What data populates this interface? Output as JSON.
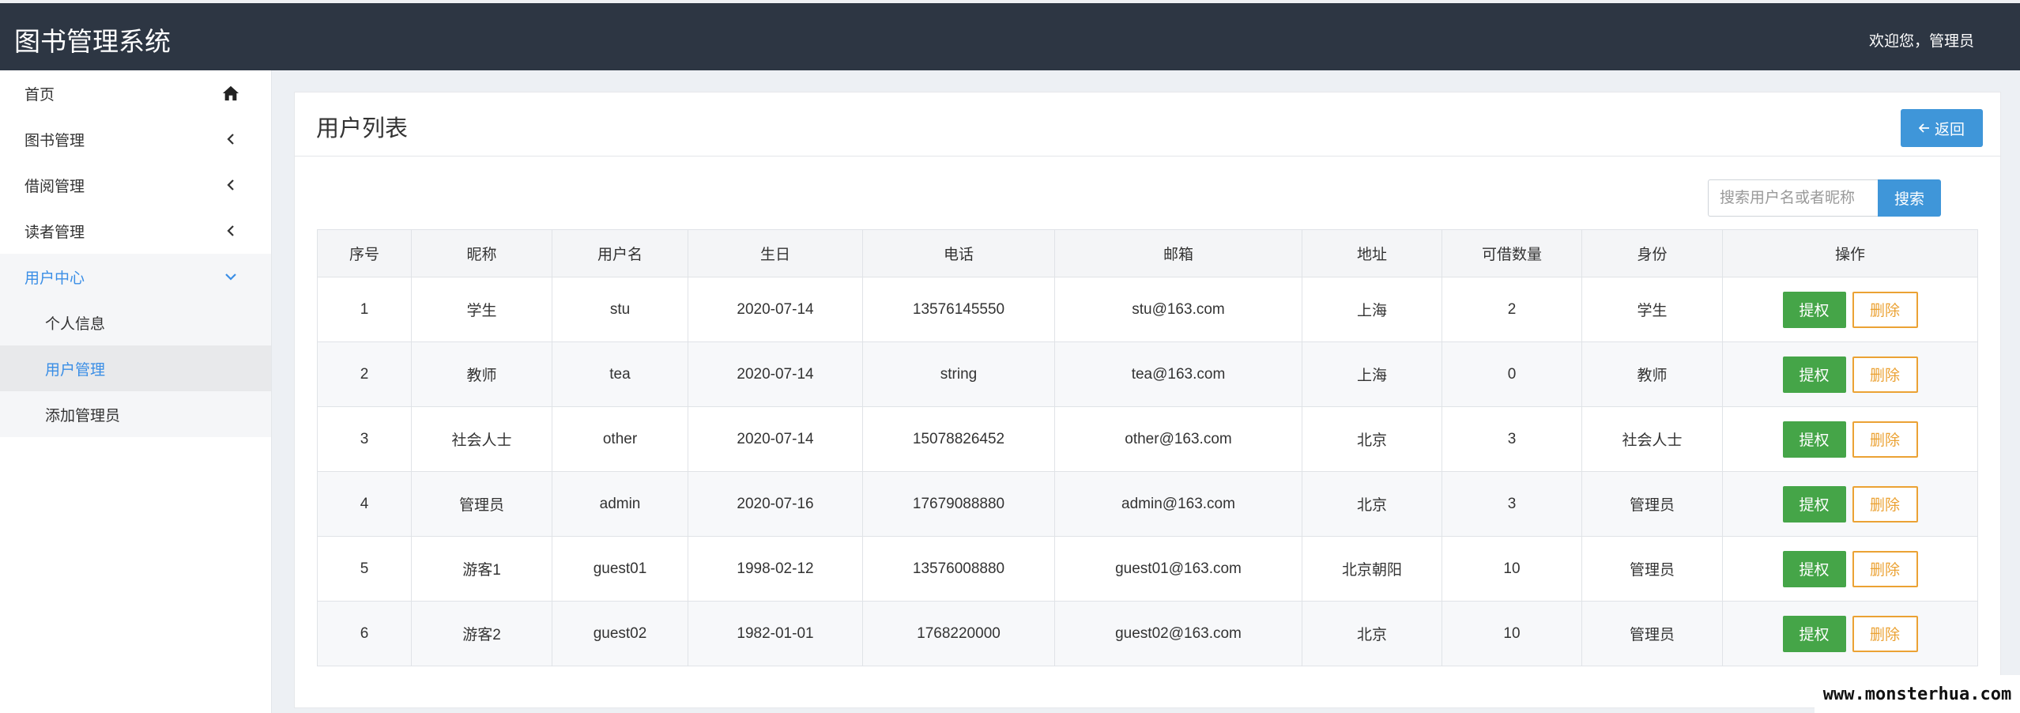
{
  "header": {
    "app_title": "图书管理系统",
    "welcome": "欢迎您，管理员"
  },
  "sidebar": {
    "items": [
      {
        "label": "首页",
        "icon": "home-icon"
      },
      {
        "label": "图书管理",
        "icon": "chevron-left-icon"
      },
      {
        "label": "借阅管理",
        "icon": "chevron-left-icon"
      },
      {
        "label": "读者管理",
        "icon": "chevron-left-icon"
      },
      {
        "label": "用户中心",
        "icon": "chevron-down-icon"
      }
    ],
    "sub_items": [
      {
        "label": "个人信息"
      },
      {
        "label": "用户管理"
      },
      {
        "label": "添加管理员"
      }
    ]
  },
  "panel": {
    "title": "用户列表",
    "back_label": "返回",
    "search_placeholder": "搜索用户名或者昵称",
    "search_label": "搜索"
  },
  "table": {
    "headers": [
      "序号",
      "昵称",
      "用户名",
      "生日",
      "电话",
      "邮箱",
      "地址",
      "可借数量",
      "身份",
      "操作"
    ],
    "grant_label": "提权",
    "delete_label": "删除",
    "rows": [
      [
        "1",
        "学生",
        "stu",
        "2020-07-14",
        "13576145550",
        "stu@163.com",
        "上海",
        "2",
        "学生"
      ],
      [
        "2",
        "教师",
        "tea",
        "2020-07-14",
        "string",
        "tea@163.com",
        "上海",
        "0",
        "教师"
      ],
      [
        "3",
        "社会人士",
        "other",
        "2020-07-14",
        "15078826452",
        "other@163.com",
        "北京",
        "3",
        "社会人士"
      ],
      [
        "4",
        "管理员",
        "admin",
        "2020-07-16",
        "17679088880",
        "admin@163.com",
        "北京",
        "3",
        "管理员"
      ],
      [
        "5",
        "游客1",
        "guest01",
        "1998-02-12",
        "13576008880",
        "guest01@163.com",
        "北京朝阳",
        "10",
        "管理员"
      ],
      [
        "6",
        "游客2",
        "guest02",
        "1982-01-01",
        "1768220000",
        "guest02@163.com",
        "北京",
        "10",
        "管理员"
      ]
    ]
  },
  "watermark": "www.monsterhua.com",
  "colors": {
    "topbar": "#2d3643",
    "accent": "#3f96d9",
    "active_link": "#3a8ee6",
    "grant": "#45a548",
    "delete": "#eba234"
  }
}
